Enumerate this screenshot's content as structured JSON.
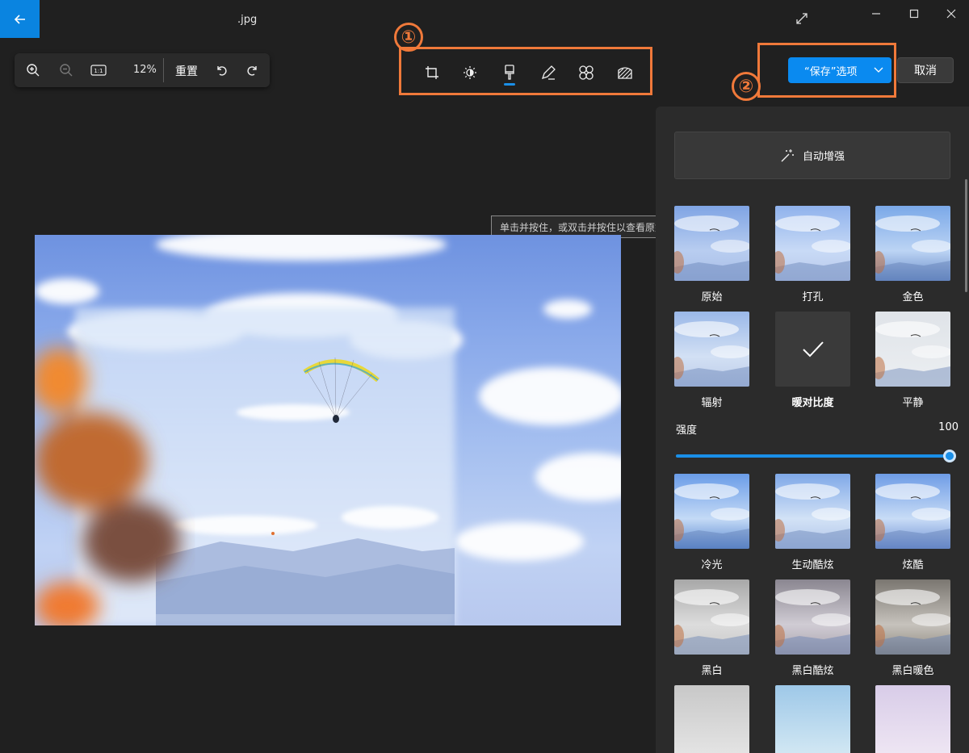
{
  "window": {
    "title": ".jpg"
  },
  "zoom_toolbar": {
    "zoom_percent": "12%",
    "actual_size_label": "1:1",
    "reset_label": "重置"
  },
  "callouts": {
    "tools": "①",
    "save": "②"
  },
  "actions": {
    "save_label": "“保存”选项",
    "cancel_label": "取消"
  },
  "canvas": {
    "tooltip": "单击并按住，或双击并按住以查看原始图像"
  },
  "panel": {
    "auto_enhance_label": "自动增强",
    "filters_top": [
      {
        "label": "原始"
      },
      {
        "label": "打孔"
      },
      {
        "label": "金色"
      },
      {
        "label": "辐射"
      },
      {
        "label": "暖对比度",
        "selected": true
      },
      {
        "label": "平静"
      }
    ],
    "strength": {
      "label": "强度",
      "value": "100",
      "fraction": 1.0
    },
    "filters_bottom": [
      {
        "label": "冷光"
      },
      {
        "label": "生动酷炫"
      },
      {
        "label": "炫酷"
      },
      {
        "label": "黑白"
      },
      {
        "label": "黑白酷炫"
      },
      {
        "label": "黑白暖色"
      }
    ]
  },
  "colors": {
    "accent": "#0a8af0",
    "callout": "#f0793a",
    "background": "#202020",
    "panel": "#2b2b2b"
  },
  "icons": {
    "back": "arrow-left-icon",
    "zoom_in": "zoom-in-icon",
    "zoom_out": "zoom-out-icon",
    "undo": "undo-icon",
    "redo": "redo-icon",
    "crop": "crop-icon",
    "adjust": "brightness-icon",
    "filter": "brush-icon",
    "markup": "pen-icon",
    "retouch": "retouch-icon",
    "red_eye": "effects-icon",
    "auto": "magic-wand-icon",
    "check": "check-icon"
  }
}
